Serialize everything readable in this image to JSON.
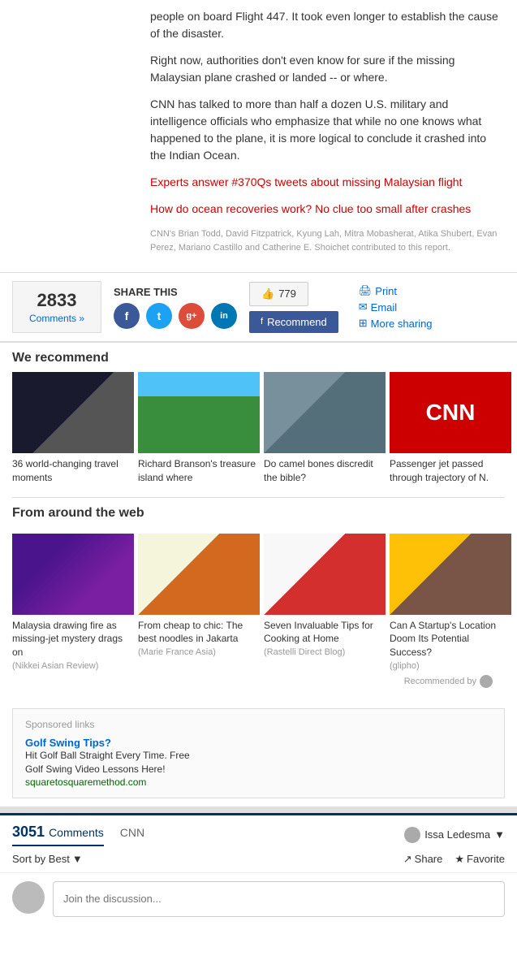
{
  "article": {
    "paragraphs": [
      "people on board Flight 447. It took even longer to establish the cause of the disaster.",
      "Right now, authorities don't even know for sure if the missing Malaysian plane crashed or landed -- or where.",
      "CNN has talked to more than half a dozen U.S. military and intelligence officials who emphasize that while no one knows what happened to the plane, it is more logical to conclude it crashed into the Indian Ocean.",
      "Experts answer #370Qs tweets about missing Malaysian flight",
      "How do ocean recoveries work? No clue too small after crashes"
    ],
    "authors": "CNN's Brian Todd, David Fitzpatrick, Kyung Lah, Mitra Mobasherat, Atika Shubert, Evan Perez, Mariano Castillo and Catherine E. Shoichet contributed to this report."
  },
  "share": {
    "title": "SHARE THIS",
    "comments_count": "2833",
    "comments_label": "Comments »",
    "like_count": "779",
    "recommend_label": "Recommend",
    "print_label": "Print",
    "email_label": "Email",
    "more_sharing_label": "More sharing",
    "social": {
      "facebook_label": "f",
      "twitter_label": "t",
      "googleplus_label": "g+",
      "linkedin_label": "in"
    }
  },
  "we_recommend": {
    "title": "We recommend",
    "cards": [
      {
        "label": "36 world-changing travel moments",
        "source": "",
        "img_class": "img-travel"
      },
      {
        "label": "Richard Branson's treasure island where",
        "source": "",
        "img_class": "img-island"
      },
      {
        "label": "Do camel bones discredit the bible?",
        "source": "",
        "img_class": "img-camel"
      },
      {
        "label": "Passenger jet passed through trajectory of N.",
        "source": "",
        "img_class": "img-cnn",
        "cnn_text": "CNN"
      }
    ]
  },
  "from_web": {
    "title": "From around the web",
    "cards": [
      {
        "label": "Malaysia drawing fire as missing-jet mystery drags on",
        "source": "(Nikkei Asian Review)",
        "img_class": "img-crowd"
      },
      {
        "label": "From cheap to chic: The best noodles in Jakarta",
        "source": "(Marie France Asia)",
        "img_class": "img-noodles"
      },
      {
        "label": "Seven Invaluable Tips for Cooking at Home",
        "source": "(Rastelli Direct Blog)",
        "img_class": "img-meat"
      },
      {
        "label": "Can A Startup's Location Doom Its Potential Success?",
        "source": "(glipho)",
        "img_class": "img-bitcoin"
      }
    ],
    "recommended_by": "Recommended by"
  },
  "sponsored": {
    "title": "Sponsored links",
    "ad_title": "Golf Swing Tips?",
    "ad_desc1": "Hit Golf Ball Straight Every Time. Free",
    "ad_desc2": "Golf Swing Video Lessons Here!",
    "ad_url": "squaretosquaremethod.com"
  },
  "comments_section": {
    "count": "3051",
    "count_label": "Comments",
    "tab_cnn": "CNN",
    "user_name": "Issa Ledesma",
    "sort_label": "Sort by Best",
    "share_label": "Share",
    "favorite_label": "Favorite",
    "input_placeholder": "Join the discussion..."
  }
}
